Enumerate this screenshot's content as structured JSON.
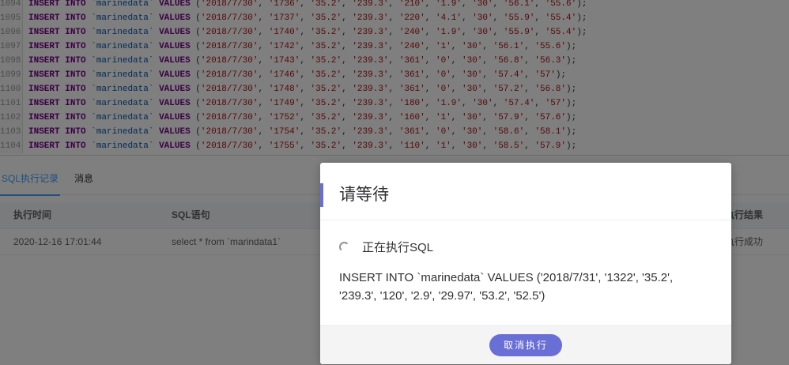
{
  "editor": {
    "lines": [
      {
        "num": "1094",
        "sql": "INSERT INTO `marinedata` VALUES ('2018/7/30', '1736', '35.2', '239.3', '210', '1.9', '30', '56.1', '55.6');"
      },
      {
        "num": "1095",
        "sql": "INSERT INTO `marinedata` VALUES ('2018/7/30', '1737', '35.2', '239.3', '220', '4.1', '30', '55.9', '55.4');"
      },
      {
        "num": "1096",
        "sql": "INSERT INTO `marinedata` VALUES ('2018/7/30', '1740', '35.2', '239.3', '240', '1.9', '30', '55.9', '55.4');"
      },
      {
        "num": "1097",
        "sql": "INSERT INTO `marinedata` VALUES ('2018/7/30', '1742', '35.2', '239.3', '240', '1', '30', '56.1', '55.6');"
      },
      {
        "num": "1098",
        "sql": "INSERT INTO `marinedata` VALUES ('2018/7/30', '1743', '35.2', '239.3', '361', '0', '30', '56.8', '56.3');"
      },
      {
        "num": "1099",
        "sql": "INSERT INTO `marinedata` VALUES ('2018/7/30', '1746', '35.2', '239.3', '361', '0', '30', '57.4', '57');"
      },
      {
        "num": "1100",
        "sql": "INSERT INTO `marinedata` VALUES ('2018/7/30', '1748', '35.2', '239.3', '361', '0', '30', '57.2', '56.8');"
      },
      {
        "num": "1101",
        "sql": "INSERT INTO `marinedata` VALUES ('2018/7/30', '1749', '35.2', '239.3', '180', '1.9', '30', '57.4', '57');"
      },
      {
        "num": "1102",
        "sql": "INSERT INTO `marinedata` VALUES ('2018/7/30', '1752', '35.2', '239.3', '160', '1', '30', '57.9', '57.6');"
      },
      {
        "num": "1103",
        "sql": "INSERT INTO `marinedata` VALUES ('2018/7/30', '1754', '35.2', '239.3', '361', '0', '30', '58.6', '58.1');"
      },
      {
        "num": "1104",
        "sql": "INSERT INTO `marinedata` VALUES ('2018/7/30', '1755', '35.2', '239.3', '110', '1', '30', '58.5', '57.9');"
      }
    ]
  },
  "tabs": [
    {
      "label": "SQL执行记录",
      "active": true
    },
    {
      "label": "消息",
      "active": false
    }
  ],
  "table": {
    "headers": {
      "time": "执行时间",
      "sql": "SQL语句",
      "result": "执行结果"
    },
    "rows": [
      {
        "time": "2020-12-16 17:01:44",
        "sql": "select * from `marindata1`",
        "result": "执行成功"
      }
    ]
  },
  "modal": {
    "title": "请等待",
    "status": "正在执行SQL",
    "sql": "INSERT INTO `marinedata` VALUES ('2018/7/31', '1322', '35.2', '239.3', '120', '2.9', '29.97', '53.2', '52.5')",
    "cancel_label": "取消执行"
  },
  "colors": {
    "accent": "#6a6fd6",
    "tab_active": "#409eff",
    "keyword": "#770088",
    "table_name": "#0055aa",
    "string": "#aa1111"
  }
}
